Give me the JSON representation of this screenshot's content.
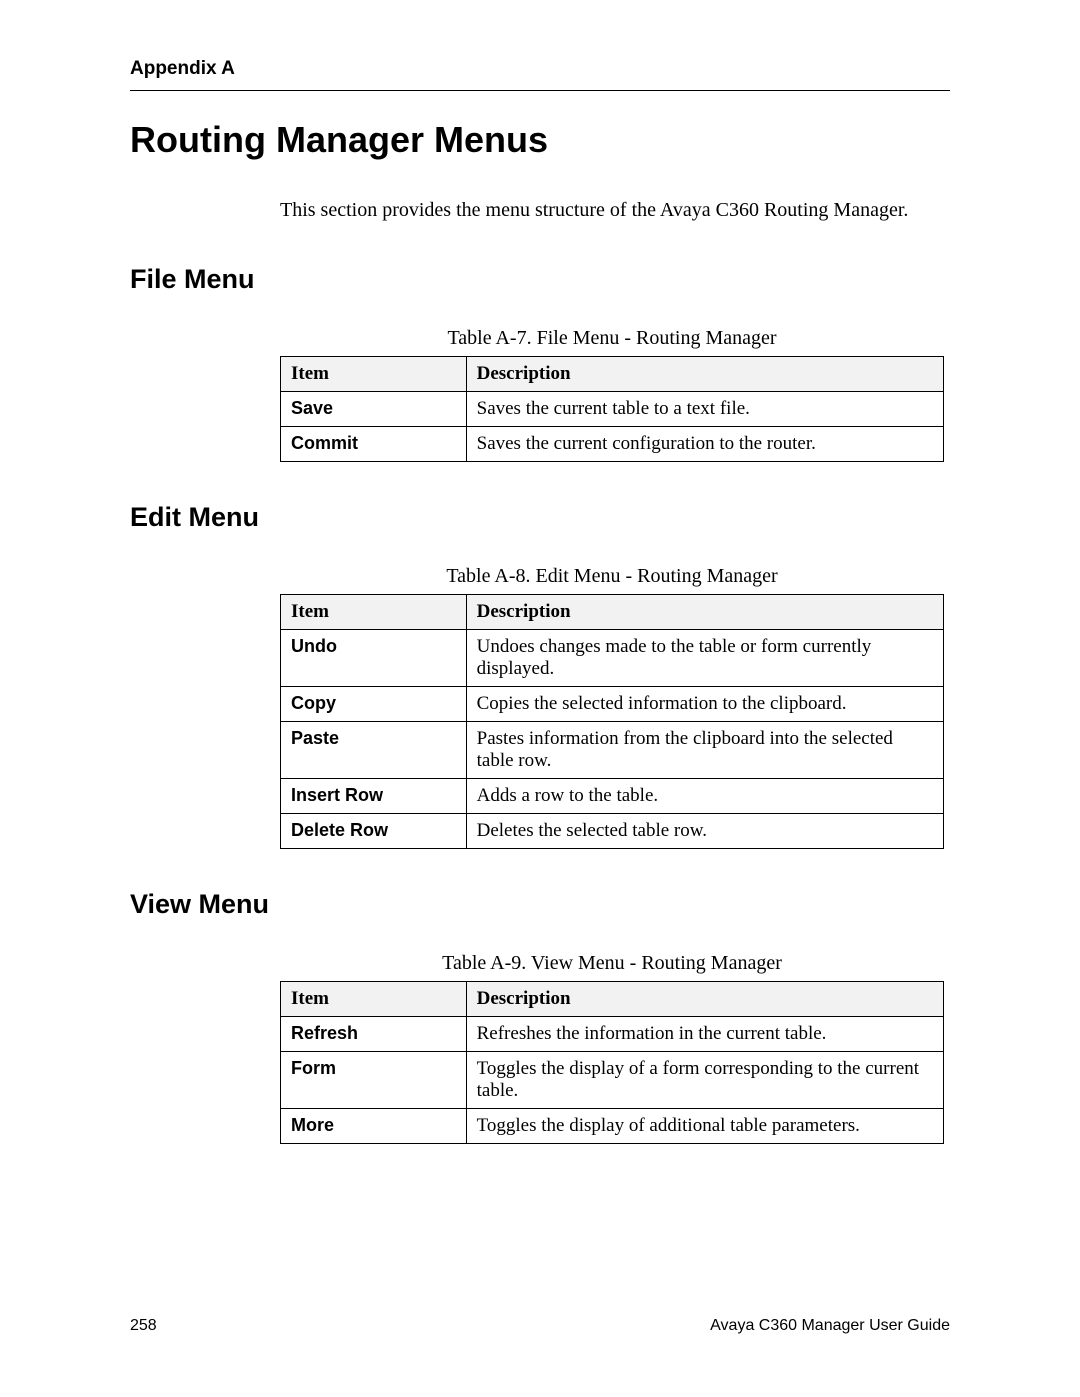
{
  "header": {
    "appendix": "Appendix A"
  },
  "title": "Routing Manager Menus",
  "intro": "This section provides the menu structure of the Avaya C360 Routing Manager.",
  "sections": {
    "file": {
      "heading": "File Menu",
      "caption": "Table A-7. File Menu - Routing Manager",
      "item_hdr": "Item",
      "desc_hdr": "Description",
      "rows": [
        {
          "item": "Save",
          "desc": "Saves the current table to a text file."
        },
        {
          "item": "Commit",
          "desc": "Saves the current configuration to the router."
        }
      ]
    },
    "edit": {
      "heading": "Edit Menu",
      "caption": "Table A-8. Edit Menu - Routing Manager",
      "item_hdr": "Item",
      "desc_hdr": "Description",
      "rows": [
        {
          "item": "Undo",
          "desc": "Undoes changes made to the table or form currently displayed."
        },
        {
          "item": "Copy",
          "desc": "Copies the selected information to the clipboard."
        },
        {
          "item": "Paste",
          "desc": "Pastes information from the clipboard into the selected table row."
        },
        {
          "item": "Insert Row",
          "desc": "Adds a row to the table."
        },
        {
          "item": "Delete Row",
          "desc": "Deletes the selected table row."
        }
      ]
    },
    "view": {
      "heading": "View Menu",
      "caption": "Table A-9. View Menu - Routing Manager",
      "item_hdr": "Item",
      "desc_hdr": "Description",
      "rows": [
        {
          "item": "Refresh",
          "desc": "Refreshes the information in the current table."
        },
        {
          "item": "Form",
          "desc": "Toggles the display of a form corresponding to the current table."
        },
        {
          "item": "More",
          "desc": "Toggles the display of additional table parameters."
        }
      ]
    }
  },
  "footer": {
    "page": "258",
    "guide": "Avaya C360 Manager User Guide"
  }
}
